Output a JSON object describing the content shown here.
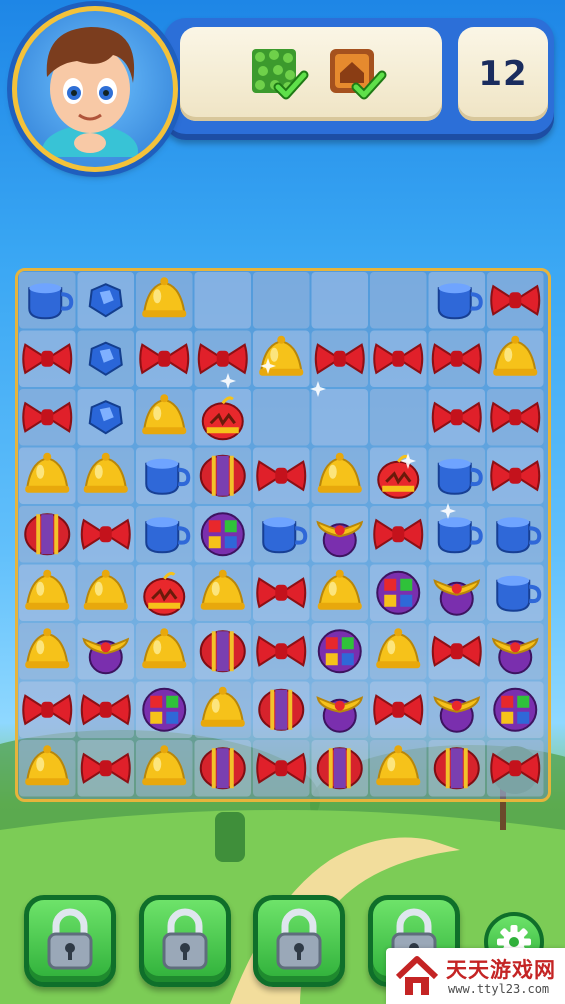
{
  "hud": {
    "moves_left": "12",
    "goals": [
      {
        "name": "grass-tile-icon",
        "completed": true
      },
      {
        "name": "crate-house-icon",
        "completed": true
      }
    ]
  },
  "board": {
    "rows": 9,
    "cols": 9,
    "grid": [
      [
        "cup",
        "gem",
        "bell",
        "",
        "",
        "",
        "",
        "cup",
        "bow"
      ],
      [
        "bow",
        "gem",
        "bow",
        "bow",
        "bell",
        "bow",
        "bow",
        "bow",
        "bell"
      ],
      [
        "bow",
        "gem",
        "bell",
        "firecracker",
        "",
        "",
        "",
        "bow",
        "bow"
      ],
      [
        "bell",
        "bell",
        "cup",
        "ball",
        "bow",
        "bell",
        "firecracker",
        "cup",
        "bow"
      ],
      [
        "ball",
        "bow",
        "cup",
        "cube",
        "cup",
        "propeller",
        "bow",
        "cup",
        "cup"
      ],
      [
        "bell",
        "bell",
        "firecracker",
        "bell",
        "bow",
        "bell",
        "cube",
        "propeller",
        "cup"
      ],
      [
        "bell",
        "propeller",
        "bell",
        "ball",
        "bow",
        "cube",
        "bell",
        "bow",
        "propeller"
      ],
      [
        "bow",
        "bow",
        "cube",
        "bell",
        "ball",
        "propeller",
        "bow",
        "propeller",
        "cube"
      ],
      [
        "bell",
        "bow",
        "bell",
        "ball",
        "bow",
        "ball",
        "bell",
        "ball",
        "bow"
      ]
    ]
  },
  "boosters": [
    {
      "name": "booster-slot-1",
      "locked": true
    },
    {
      "name": "booster-slot-2",
      "locked": true
    },
    {
      "name": "booster-slot-3",
      "locked": true
    },
    {
      "name": "booster-slot-4",
      "locked": true
    }
  ],
  "settings": {
    "icon": "gear-icon"
  },
  "watermark": {
    "title": "天天游戏网",
    "url": "www.ttyl23.com"
  }
}
